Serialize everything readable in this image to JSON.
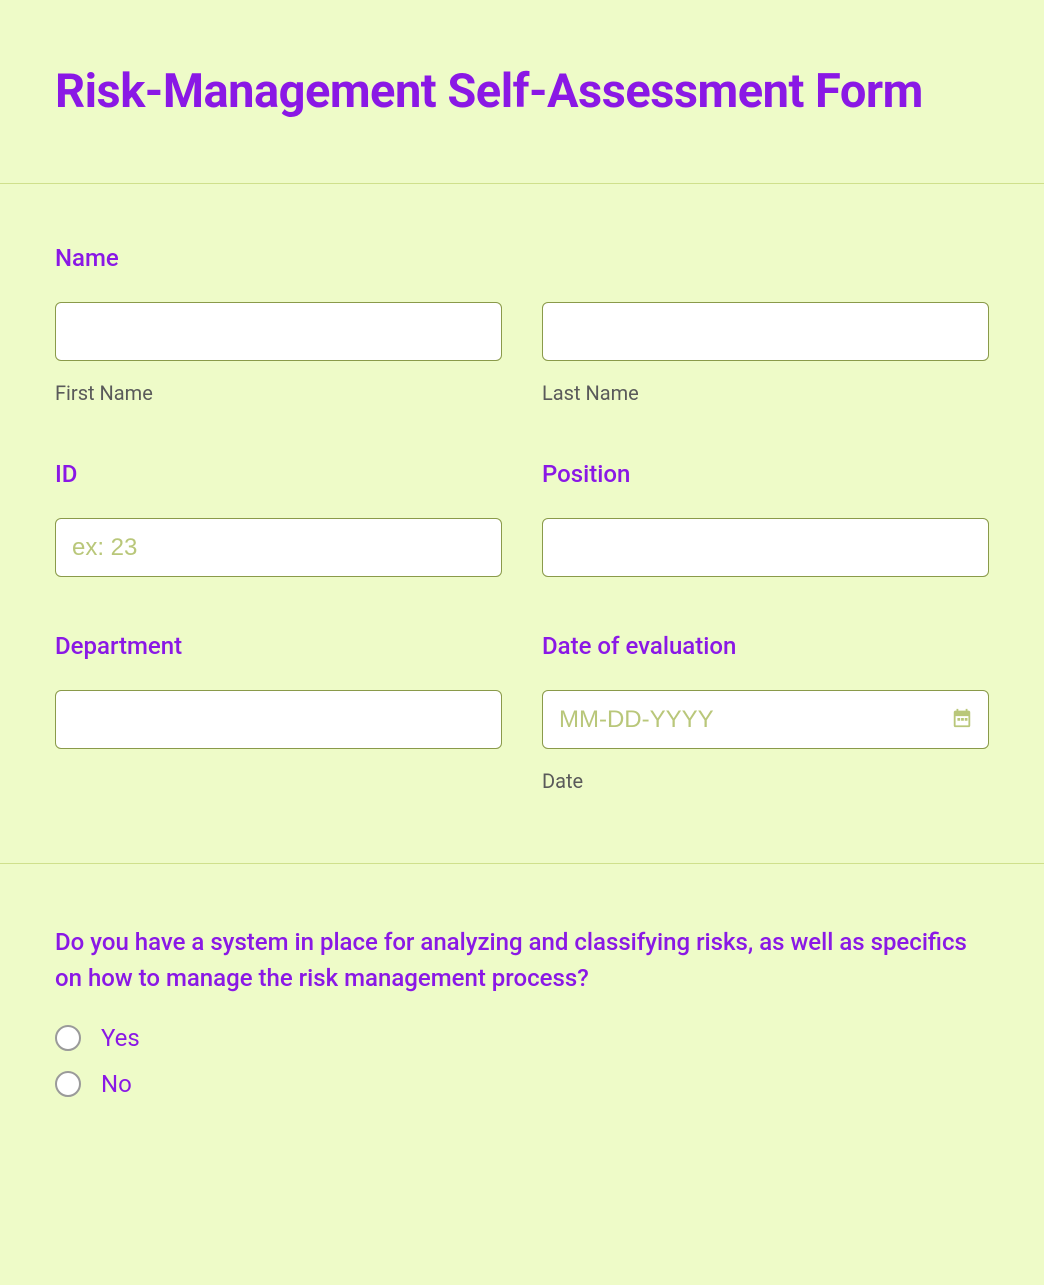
{
  "title": "Risk-Management Self-Assessment Form",
  "sections": {
    "name": {
      "label": "Name",
      "first_sub": "First Name",
      "last_sub": "Last Name"
    },
    "id": {
      "label": "ID",
      "placeholder": "ex: 23"
    },
    "position": {
      "label": "Position"
    },
    "department": {
      "label": "Department"
    },
    "date": {
      "label": "Date of evaluation",
      "placeholder": "MM-DD-YYYY",
      "sublabel": "Date"
    }
  },
  "question": {
    "text": "Do you have a system in place for analyzing and classifying risks, as well as specifics on how to manage the risk management process?",
    "options": {
      "yes": "Yes",
      "no": "No"
    }
  }
}
